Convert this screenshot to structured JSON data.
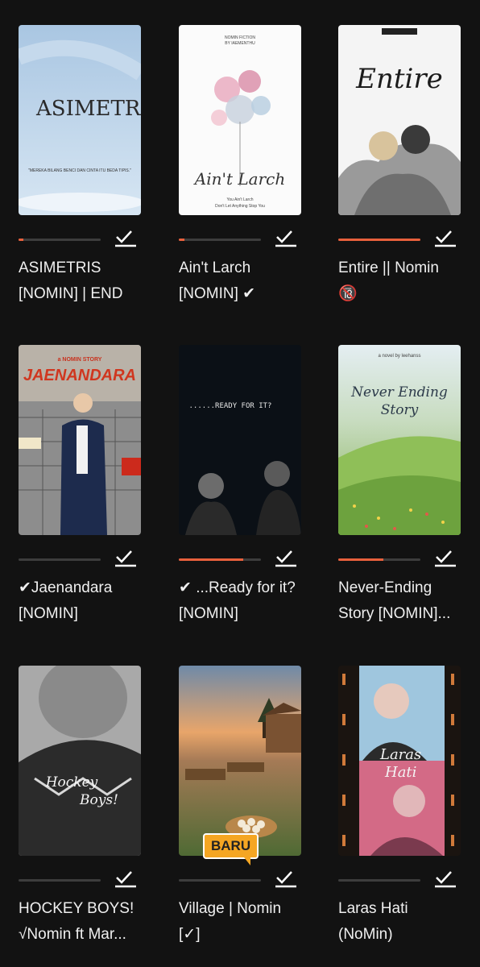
{
  "accent_color": "#e8603c",
  "check_icon": "check-icon",
  "books": [
    {
      "title_line1": "ASIMETRIS",
      "title_line2": "[NOMIN] | END",
      "progress": 0.06,
      "cover_text": "ASIMETRIS",
      "cover_sub": "\"MEREKA BILANG BENCI DAN CINTA ITU BEDA TIPIS.\""
    },
    {
      "title_line1": "Ain't Larch",
      "title_line2": "[NOMIN] ✔",
      "progress": 0.07,
      "cover_top": "NOMIN FICTION",
      "cover_top2": "BY IAEMENTHU",
      "cover_text": "Ain't Larch",
      "cover_sub": "You Ain't Larch",
      "cover_sub2": "Don't Let Anything Stop You"
    },
    {
      "title_line1": "Entire || Nomin",
      "title_line2": "🔞",
      "progress": 1.0,
      "cover_text": "Entire"
    },
    {
      "title_line1": "✔Jaenandara",
      "title_line2": "[NOMIN]",
      "progress": 0.0,
      "cover_top": "a NOMIN STORY",
      "cover_text": "JAENANDARA"
    },
    {
      "title_line1": "✔ ...Ready for it?",
      "title_line2": "[NOMIN]",
      "progress": 0.78,
      "cover_text": "......READY FOR IT?"
    },
    {
      "title_line1": "Never-Ending",
      "title_line2": "Story [NOMIN]...",
      "progress": 0.55,
      "cover_top": "a novel by leehanss",
      "cover_text": "Never Ending",
      "cover_text2": "Story"
    },
    {
      "title_line1": "HOCKEY BOYS!",
      "title_line2": "√Nomin ft Mar...",
      "progress": 0.0,
      "cover_text": "Hockey",
      "cover_text2": "Boys!"
    },
    {
      "title_line1": "Village | Nomin",
      "title_line2": "[✓]",
      "progress": 0.0,
      "badge": "BARU"
    },
    {
      "title_line1": "Laras Hati",
      "title_line2": "(NoMin)",
      "progress": 0.0,
      "cover_text": "Laras",
      "cover_text2": "Hati"
    }
  ]
}
